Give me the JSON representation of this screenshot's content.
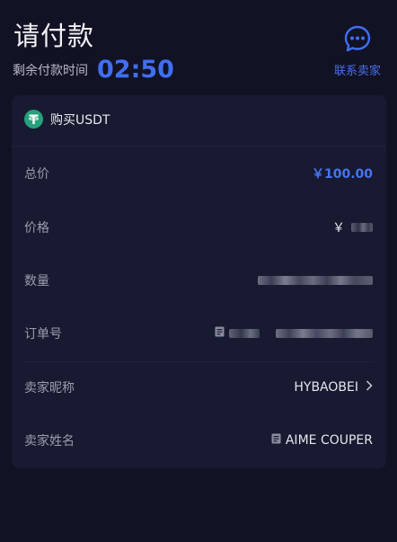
{
  "header": {
    "title": "请付款",
    "timer_label": "剩余付款时间",
    "timer_value": "02:50",
    "contact_label": "联系卖家",
    "contact_icon": "chat-bubble-icon"
  },
  "order": {
    "asset_label": "购买USDT",
    "asset_icon": "tether-icon",
    "rows": [
      {
        "label": "总价",
        "value": "￥100.00"
      },
      {
        "label": "价格",
        "value": "￥"
      },
      {
        "label": "数量",
        "value": ""
      },
      {
        "label": "订单号",
        "value": ""
      },
      {
        "label": "卖家昵称",
        "value": "HYBAOBEI"
      },
      {
        "label": "卖家姓名",
        "value": "AIME COUPER"
      }
    ]
  },
  "colors": {
    "accent": "#3f6ef1",
    "background": "#121225",
    "card": "#171a30",
    "tether": "#26a17b"
  }
}
